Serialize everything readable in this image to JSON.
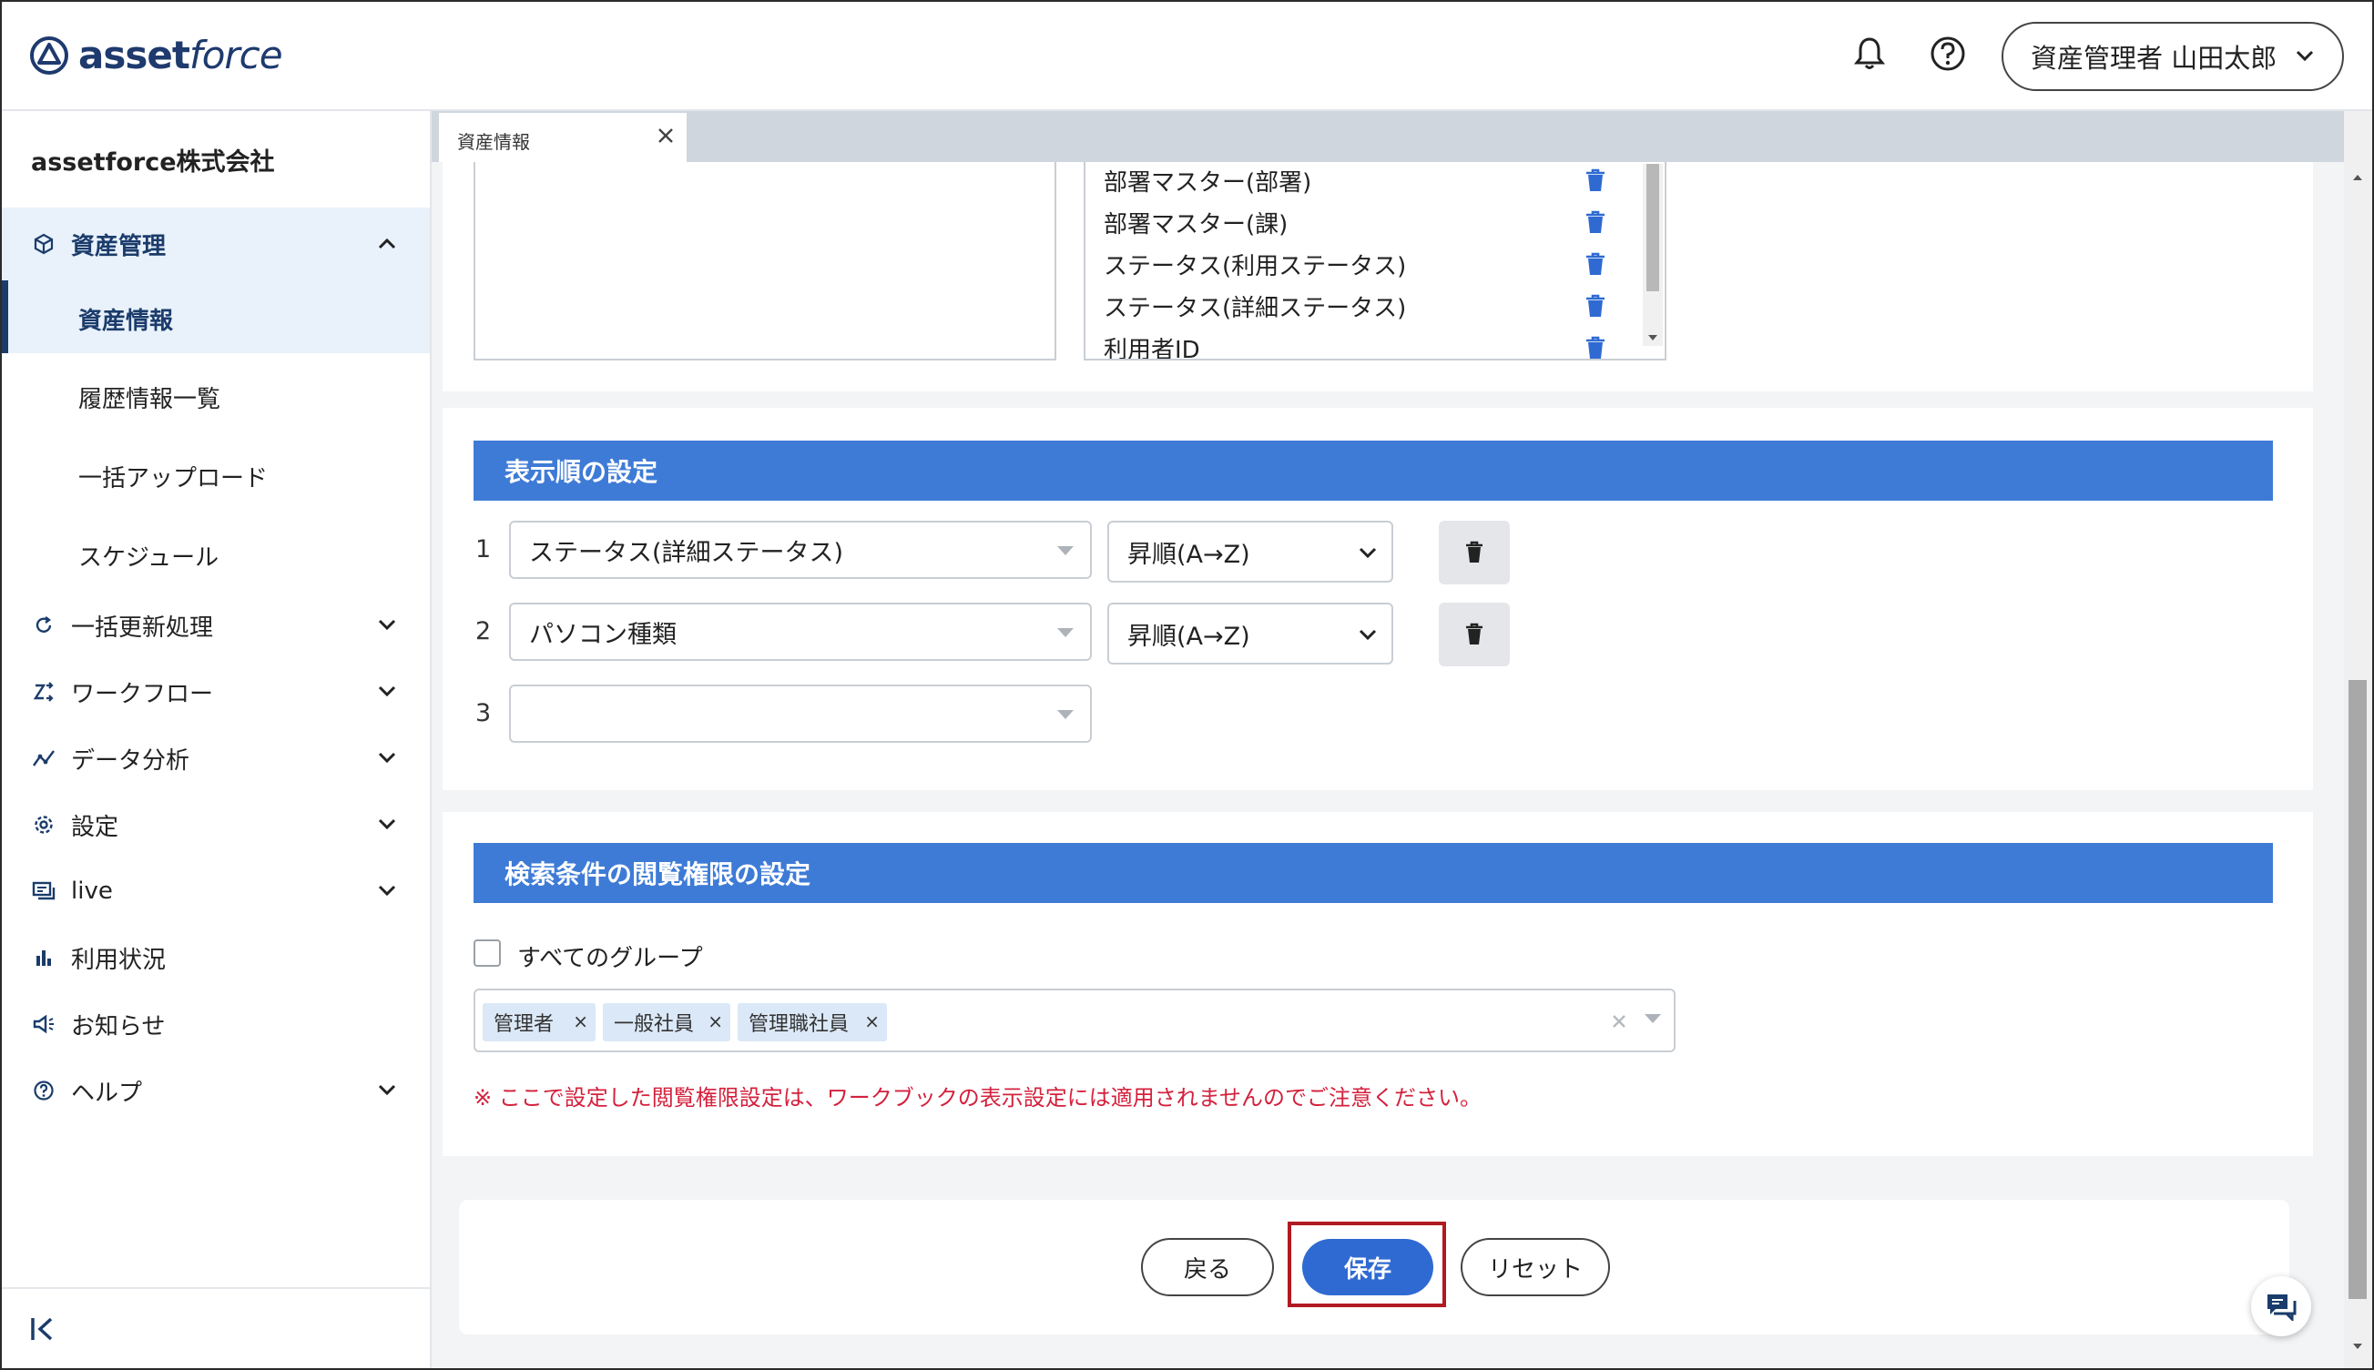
{
  "header": {
    "logo_bold": "asset",
    "logo_light": "force",
    "user_label": "資産管理者 山田太郎"
  },
  "sidebar": {
    "company": "assetforce株式会社",
    "items": [
      {
        "label": "資産管理",
        "icon": "box-icon",
        "expanded": true
      },
      {
        "label": "一括更新処理",
        "icon": "refresh-icon"
      },
      {
        "label": "ワークフロー",
        "icon": "workflow-icon"
      },
      {
        "label": "データ分析",
        "icon": "analytics-icon"
      },
      {
        "label": "設定",
        "icon": "gear-icon"
      },
      {
        "label": "live",
        "icon": "live-icon"
      },
      {
        "label": "利用状況",
        "icon": "bar-chart-icon"
      },
      {
        "label": "お知らせ",
        "icon": "megaphone-icon"
      },
      {
        "label": "ヘルプ",
        "icon": "help-icon"
      }
    ],
    "sub_items": [
      {
        "label": "資産情報",
        "active": true
      },
      {
        "label": "履歴情報一覧"
      },
      {
        "label": "一括アップロード"
      },
      {
        "label": "スケジュール"
      }
    ]
  },
  "tabs": [
    {
      "label": "資産情報"
    }
  ],
  "column_list": {
    "items": [
      "部署マスター(部署)",
      "部署マスター(課)",
      "ステータス(利用ステータス)",
      "ステータス(詳細ステータス)",
      "利用者ID"
    ]
  },
  "sort_section": {
    "title": "表示順の設定",
    "rows": [
      {
        "index": "1",
        "field": "ステータス(詳細ステータス)",
        "order": "昇順(A→Z)"
      },
      {
        "index": "2",
        "field": "パソコン種類",
        "order": "昇順(A→Z)"
      },
      {
        "index": "3",
        "field": "",
        "order": ""
      }
    ]
  },
  "permission_section": {
    "title": "検索条件の閲覧権限の設定",
    "all_groups_label": "すべてのグループ",
    "all_groups_checked": false,
    "tags": [
      "管理者",
      "一般社員",
      "管理職社員"
    ],
    "note": "※ ここで設定した閲覧権限設定は、ワークブックの表示設定には適用されませんのでご注意ください。"
  },
  "footer_buttons": {
    "back": "戻る",
    "save": "保存",
    "reset": "リセット"
  },
  "colors": {
    "section_header": "#3e7bd6",
    "primary_button": "#2f6ad2",
    "highlight_border": "#b11a22",
    "note_text": "#d4213d",
    "trash_blue": "#2f6ad2"
  }
}
